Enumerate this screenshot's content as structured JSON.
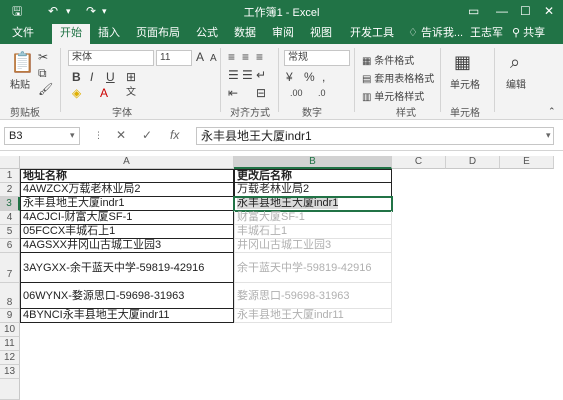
{
  "window": {
    "title": "工作簿1 - Excel",
    "quick_access": [
      "save-icon",
      "undo-icon",
      "redo-icon"
    ],
    "controls": [
      "ribbon-display-icon",
      "minimize-icon",
      "maximize-icon",
      "close-icon"
    ]
  },
  "tabs": [
    "文件",
    "开始",
    "插入",
    "页面布局",
    "公式",
    "数据",
    "审阅",
    "视图",
    "开发工具"
  ],
  "tab_extra": {
    "tell_me": "告诉我...",
    "user": "王志军",
    "share": "共享"
  },
  "ribbon": {
    "paste_label": "粘贴",
    "font_name": "宋体",
    "font_size": "11",
    "number_format": "常规",
    "cond_format": "条件格式",
    "table_format": "套用表格格式",
    "cell_style": "单元格样式",
    "cells_label": "单元格",
    "edit_label": "编辑",
    "group_labels": [
      "剪贴板",
      "字体",
      "对齐方式",
      "数字",
      "样式",
      "单元格"
    ]
  },
  "formula_bar": {
    "name_box": "B3",
    "value": "永丰县地王大厦indr1"
  },
  "columns": [
    "A",
    "B",
    "C",
    "D",
    "E"
  ],
  "rows": [
    "1",
    "2",
    "3",
    "4",
    "5",
    "6",
    "7",
    "8",
    "9",
    "10",
    "11",
    "12",
    "13"
  ],
  "sheet": {
    "A": [
      "地址名称",
      "4AWZCX万载老林业局2",
      "永丰县地王大厦indr1",
      "4ACJCI-财富大厦SF-1",
      "05FCCX丰城石上1",
      "4AGSXX井冈山古城工业园3",
      "3AYGXX-余干蓝天中学-59819-42916",
      "06WYNX-婺源思口-59698-31963",
      "4BYNCI永丰县地王大厦indr11"
    ],
    "B": [
      "更改后名称",
      "万载老林业局2",
      "永丰县地王大厦indr1",
      "财富大厦SF-1",
      "丰城石上1",
      "井冈山古城工业园3",
      "余干蓝天中学-59819-42916",
      "婺源思口-59698-31963",
      "永丰县地王大厦indr11"
    ]
  }
}
